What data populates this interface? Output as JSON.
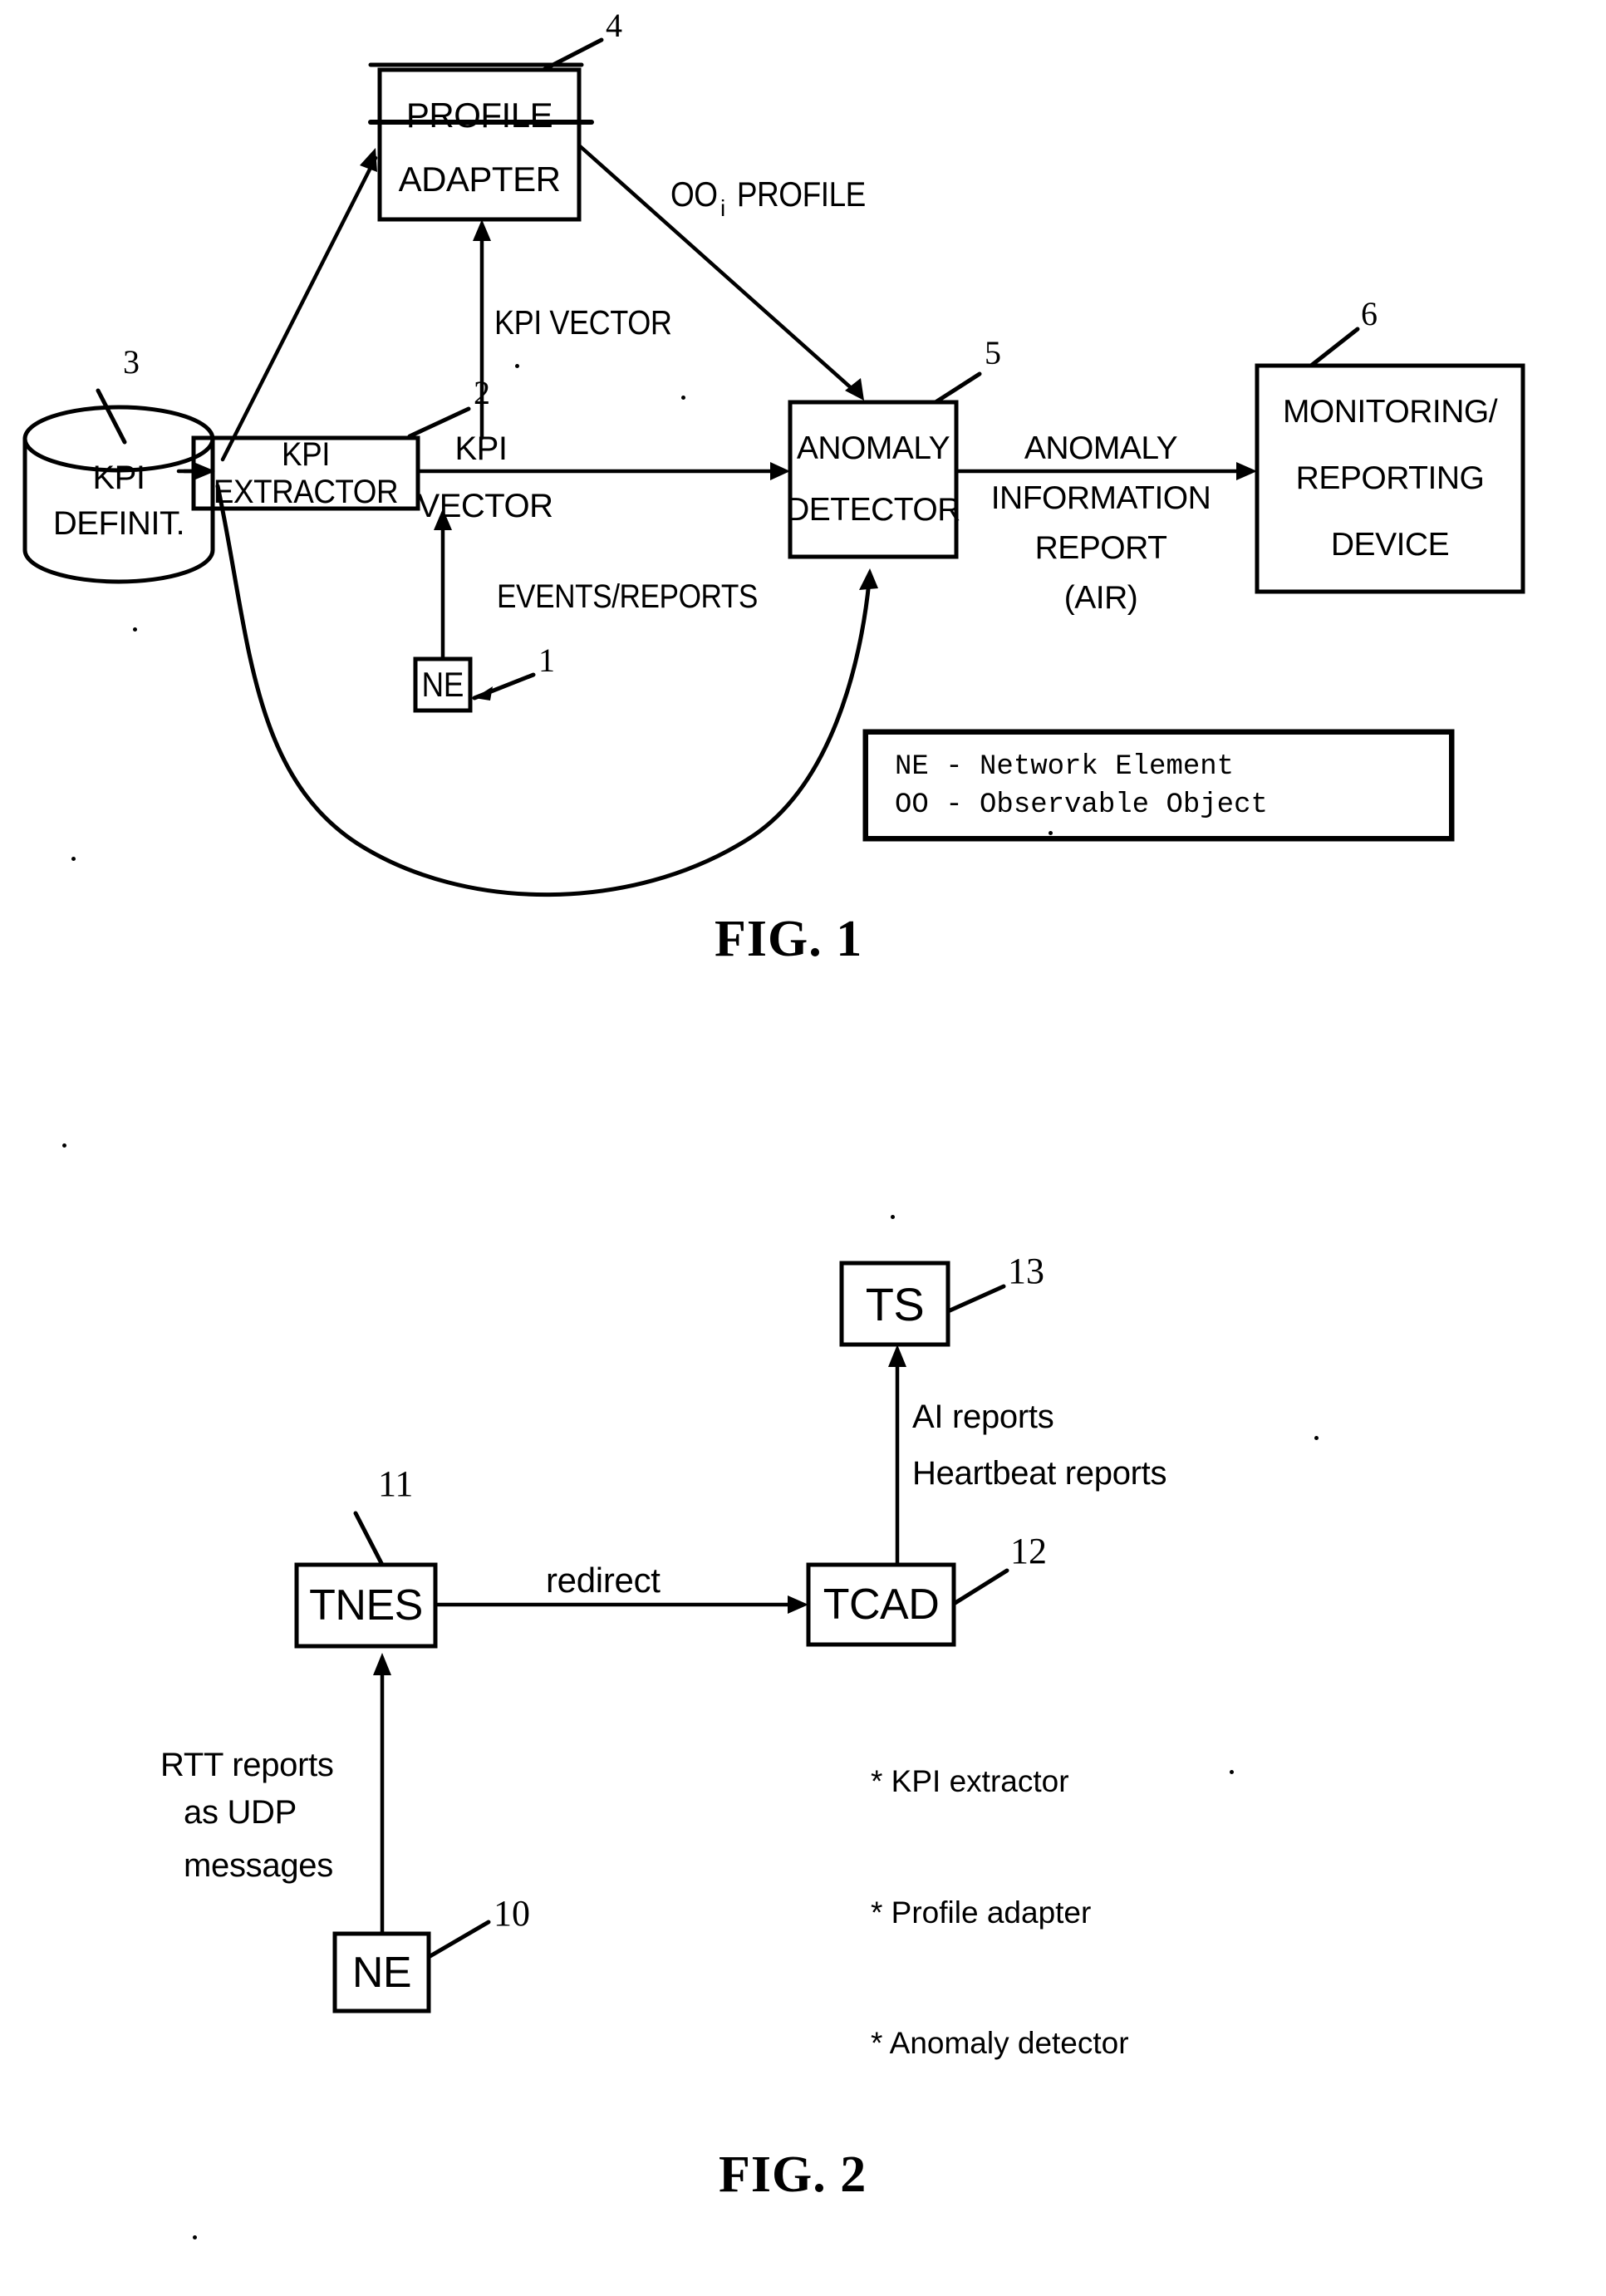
{
  "document": {
    "type": "patent-drawing-sheet",
    "figures": [
      "FIG. 1",
      "FIG. 2"
    ],
    "ink_color": "#000000",
    "paper_color": "#ffffff"
  },
  "fig1": {
    "caption": "FIG. 1",
    "blocks": {
      "profile_adapter": {
        "line1": "PROFILE",
        "line2": "ADAPTER",
        "ref": "4"
      },
      "kpi_definitions": {
        "line1": "KPI",
        "line2": "DEFINIT.",
        "ref": "3",
        "shape": "cylinder-database"
      },
      "kpi_extractor": {
        "label": "KPI EXTRACTOR",
        "ref": "2"
      },
      "anomaly_detector": {
        "line1": "ANOMALY",
        "line2": "DETECTOR",
        "ref": "5"
      },
      "monitoring_reporting_device": {
        "line1": "MONITORING/",
        "line2": "REPORTING",
        "line3": "DEVICE",
        "ref": "6"
      },
      "network_element": {
        "label": "NE",
        "ref": "1"
      }
    },
    "edge_labels": {
      "oo_profile_prefix": "OO",
      "oo_profile_subscript": "i",
      "oo_profile_suffix": " PROFILE",
      "kpi_vector_vertical": "KPI VECTOR",
      "kpi_vector_h_line1": "KPI",
      "kpi_vector_h_line2": "VECTOR",
      "events_reports": "EVENTS/REPORTS",
      "air_line1": "ANOMALY",
      "air_line2": "INFORMATION",
      "air_line3": "REPORT",
      "air_line4": "(AIR)"
    },
    "legend": {
      "line1": "NE - Network Element",
      "line2": "OO - Observable Object"
    }
  },
  "fig2": {
    "caption": "FIG. 2",
    "blocks": {
      "trace_server": {
        "label": "TS",
        "ref": "13"
      },
      "tnes": {
        "label": "TNES",
        "ref": "11"
      },
      "tcad": {
        "label": "TCAD",
        "ref": "12"
      },
      "network_element": {
        "label": "NE",
        "ref": "10"
      }
    },
    "edge_labels": {
      "redirect": "redirect",
      "ts_reports_line1": "AI reports",
      "ts_reports_line2": "Heartbeat reports",
      "ne_reports_line1": "RTT reports",
      "ne_reports_line2": "as UDP",
      "ne_reports_line3": "messages"
    },
    "tcad_functions": [
      "* KPI extractor",
      "* Profile adapter",
      "* Anomaly detector"
    ]
  }
}
